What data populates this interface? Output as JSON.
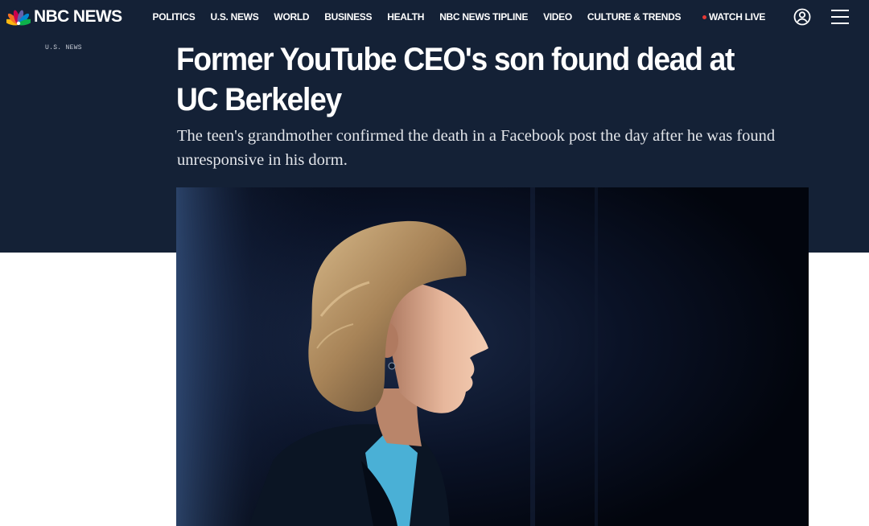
{
  "header": {
    "logo_text": "NBC NEWS",
    "nav": [
      {
        "label": "POLITICS"
      },
      {
        "label": "U.S. NEWS"
      },
      {
        "label": "WORLD"
      },
      {
        "label": "BUSINESS"
      },
      {
        "label": "HEALTH"
      },
      {
        "label": "NBC NEWS TIPLINE"
      },
      {
        "label": "VIDEO"
      },
      {
        "label": "CULTURE & TRENDS"
      }
    ],
    "watch_live_label": "WATCH LIVE",
    "live_dot_color": "#e53935",
    "account_icon": "account-circle-icon",
    "menu_icon": "hamburger-menu-icon"
  },
  "article": {
    "eyebrow": "U.S. NEWS",
    "headline": "Former YouTube CEO's son found dead at UC Berkeley",
    "dek": "The teen's grandmother confirmed the death in a Facebook post the day after he was found unresponsive in his dorm."
  },
  "colors": {
    "hero_background": "#142136",
    "page_background": "#ffffff"
  }
}
